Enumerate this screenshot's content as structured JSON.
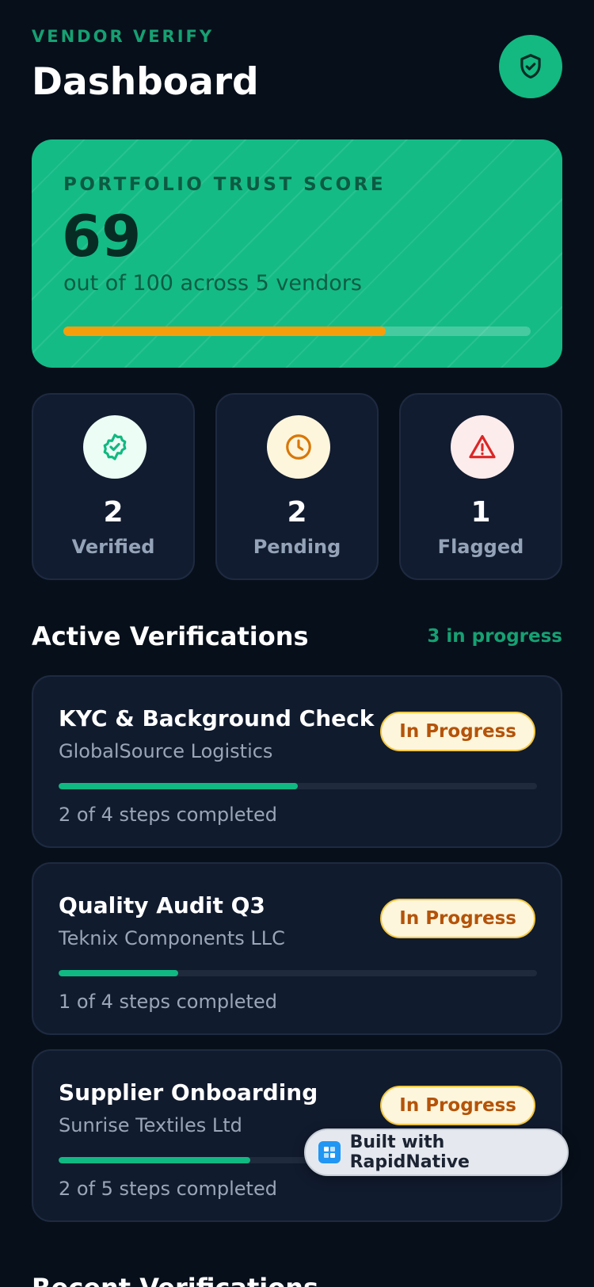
{
  "header": {
    "brand": "VENDOR VERIFY",
    "title": "Dashboard",
    "action_icon": "shield-check-icon"
  },
  "trust": {
    "label": "PORTFOLIO TRUST SCORE",
    "score": "69",
    "subtitle": "out of 100 across 5 vendors",
    "progress": 0.69
  },
  "stats": [
    {
      "icon": "badge-check-icon",
      "value": "2",
      "label": "Verified",
      "color": "#10b981",
      "bg": "#ecfdf5"
    },
    {
      "icon": "clock-icon",
      "value": "2",
      "label": "Pending",
      "color": "#d97706",
      "bg": "#fef6dc"
    },
    {
      "icon": "alert-triangle-icon",
      "value": "1",
      "label": "Flagged",
      "color": "#dc2626",
      "bg": "#fdecec"
    }
  ],
  "active": {
    "title": "Active Verifications",
    "meta": "3 in progress",
    "items": [
      {
        "title": "KYC & Background Check",
        "vendor": "GlobalSource Logistics",
        "status": "In Progress",
        "steps": "2 of 4 steps completed",
        "progress": 0.5
      },
      {
        "title": "Quality Audit Q3",
        "vendor": "Teknix Components LLC",
        "status": "In Progress",
        "steps": "1 of 4 steps completed",
        "progress": 0.25
      },
      {
        "title": "Supplier Onboarding",
        "vendor": "Sunrise Textiles Ltd",
        "status": "In Progress",
        "steps": "2 of 5 steps completed",
        "progress": 0.4
      }
    ]
  },
  "built_with": "Built with RapidNative",
  "next_section_title": "Recent Verifications",
  "colors": {
    "accent": "#10b981",
    "background": "#070f1a",
    "card": "#111b2e",
    "warning": "#f59e0b"
  }
}
